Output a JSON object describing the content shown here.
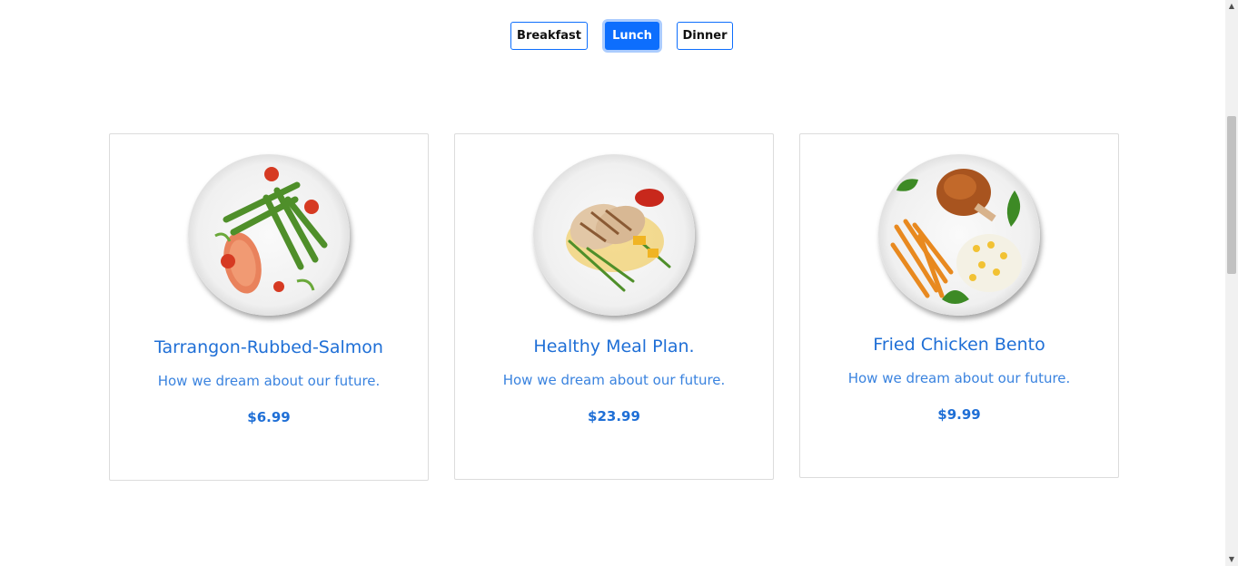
{
  "tabs": [
    {
      "label": "Breakfast",
      "active": false
    },
    {
      "label": "Lunch",
      "active": true
    },
    {
      "label": "Dinner",
      "active": false
    }
  ],
  "cards": [
    {
      "title": "Tarrangon-Rubbed-Salmon",
      "description": "How we dream about our future.",
      "price": "$6.99",
      "image": "salmon-asparagus-plate"
    },
    {
      "title": "Healthy Meal Plan.",
      "description": "How we dream about our future.",
      "price": "$23.99",
      "image": "grilled-chicken-plate"
    },
    {
      "title": "Fried Chicken Bento",
      "description": "How we dream about our future.",
      "price": "$9.99",
      "image": "fried-chicken-fries-rice-plate"
    }
  ],
  "colors": {
    "accent": "#0d6efd",
    "title_text": "#1f6fd6",
    "card_border": "#dcdcdc"
  },
  "scrollbar": {
    "up_icon": "triangle-up",
    "down_icon": "triangle-down"
  }
}
